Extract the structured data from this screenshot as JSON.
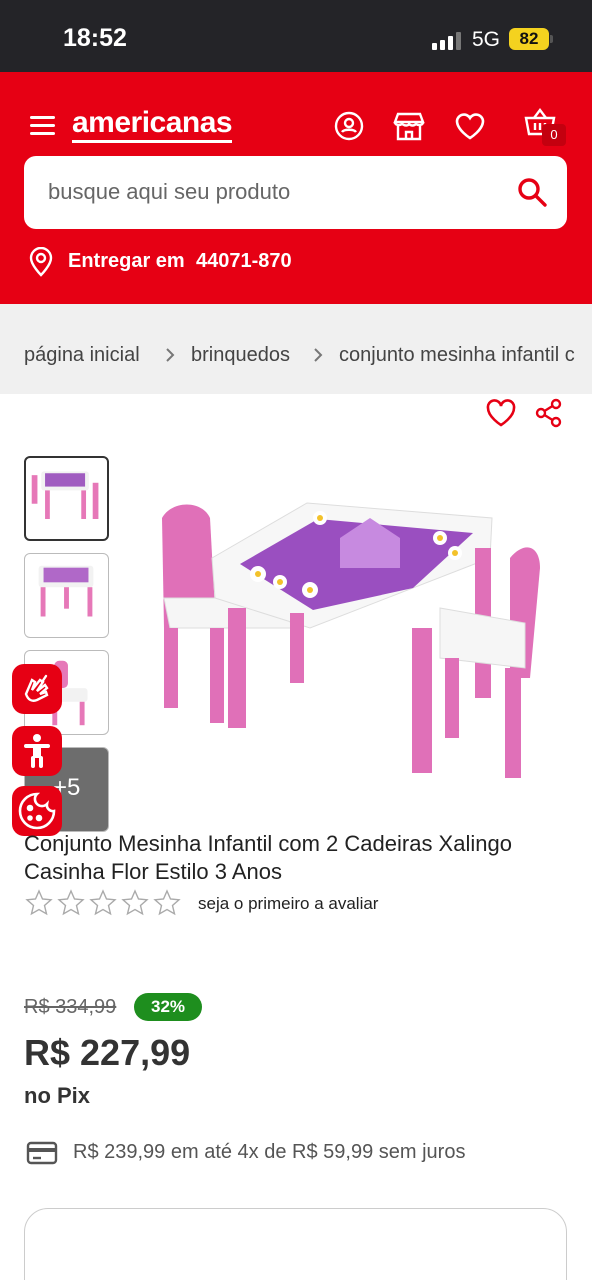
{
  "status_bar": {
    "time": "18:52",
    "network": "5G",
    "battery": "82"
  },
  "header": {
    "logo": "americanas",
    "search": {
      "placeholder": "busque aqui seu produto"
    },
    "cart_count": "0",
    "delivery": {
      "label": "Entregar em",
      "cep": "44071-870"
    },
    "icons": [
      "menu-icon",
      "user-icon",
      "store-icon",
      "heart-icon",
      "basket-icon",
      "search-icon",
      "location-pin-icon"
    ]
  },
  "breadcrumb": [
    "página inicial",
    "brinquedos",
    "conjunto mesinha infantil c"
  ],
  "gallery": {
    "more_label": "+5"
  },
  "product": {
    "title": "Conjunto Mesinha Infantil com 2 Cadeiras Xalingo Casinha Flor Estilo 3 Anos",
    "rating": {
      "stars": 0,
      "max": 5,
      "text": "seja o primeiro a avaliar"
    },
    "old_price": "R$ 334,99",
    "discount": "32%",
    "price": "R$ 227,99",
    "price_method": "no Pix",
    "installments": "R$ 239,99 em até 4x de R$ 59,99 sem juros"
  },
  "colors": {
    "brand": "#e60014",
    "discount_green": "#1e8e1e",
    "status_bar": "#242428"
  }
}
